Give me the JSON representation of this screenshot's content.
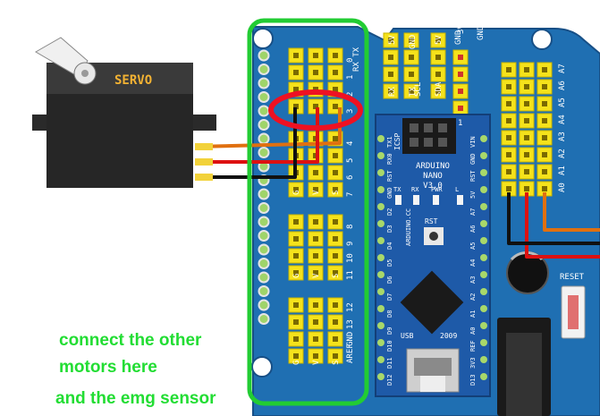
{
  "servo": {
    "label": "SERVO"
  },
  "nano": {
    "title": "ARDUINO",
    "model": "NANO",
    "version": "V3.0",
    "icsp": "ICSP",
    "icsp_num": "1",
    "led_labels": [
      "TX",
      "RX",
      "PWR",
      "L"
    ],
    "rst": "RST",
    "site": "ARDUINO.CC",
    "usb": "USB",
    "year": "2009",
    "left_pins": [
      "D12",
      "D11",
      "D10",
      "D9",
      "D8",
      "D7",
      "D6",
      "D5",
      "D4",
      "D3",
      "D2",
      "GND",
      "RST",
      "RX0",
      "TX1"
    ],
    "right_pins": [
      "D13",
      "3V3",
      "REF",
      "A0",
      "A1",
      "A2",
      "A3",
      "A4",
      "A5",
      "A6",
      "A7",
      "5V",
      "RST",
      "GND",
      "VIN"
    ]
  },
  "shield": {
    "top_header_labels": [
      "RX",
      "TX",
      "5V",
      "GND",
      "SCL",
      "SDA",
      "5V",
      "GND",
      "3V3",
      "GND"
    ],
    "digital_numbers": [
      "0",
      "1",
      "2",
      "3",
      "4",
      "5",
      "6",
      "7",
      "8",
      "9",
      "10",
      "11",
      "12",
      "13",
      "GND",
      "AREF"
    ],
    "row_labels": [
      "G",
      "V",
      "S"
    ],
    "analog_labels": [
      "A0",
      "A1",
      "A2",
      "A3",
      "A4",
      "A5",
      "A6",
      "A7"
    ],
    "reset": "RESET"
  },
  "annotations": {
    "line1": "connect the other",
    "line2": "motors here",
    "line3": "and the emg sensor"
  },
  "colors": {
    "board": "#1f6fb2",
    "nano": "#1e5aa8",
    "header": "#f5e21b",
    "highlight_box": "#22cc33",
    "highlight_circle": "#ee1122",
    "wire_signal": "#e07010",
    "wire_power": "#dd1111",
    "wire_ground": "#111111"
  }
}
